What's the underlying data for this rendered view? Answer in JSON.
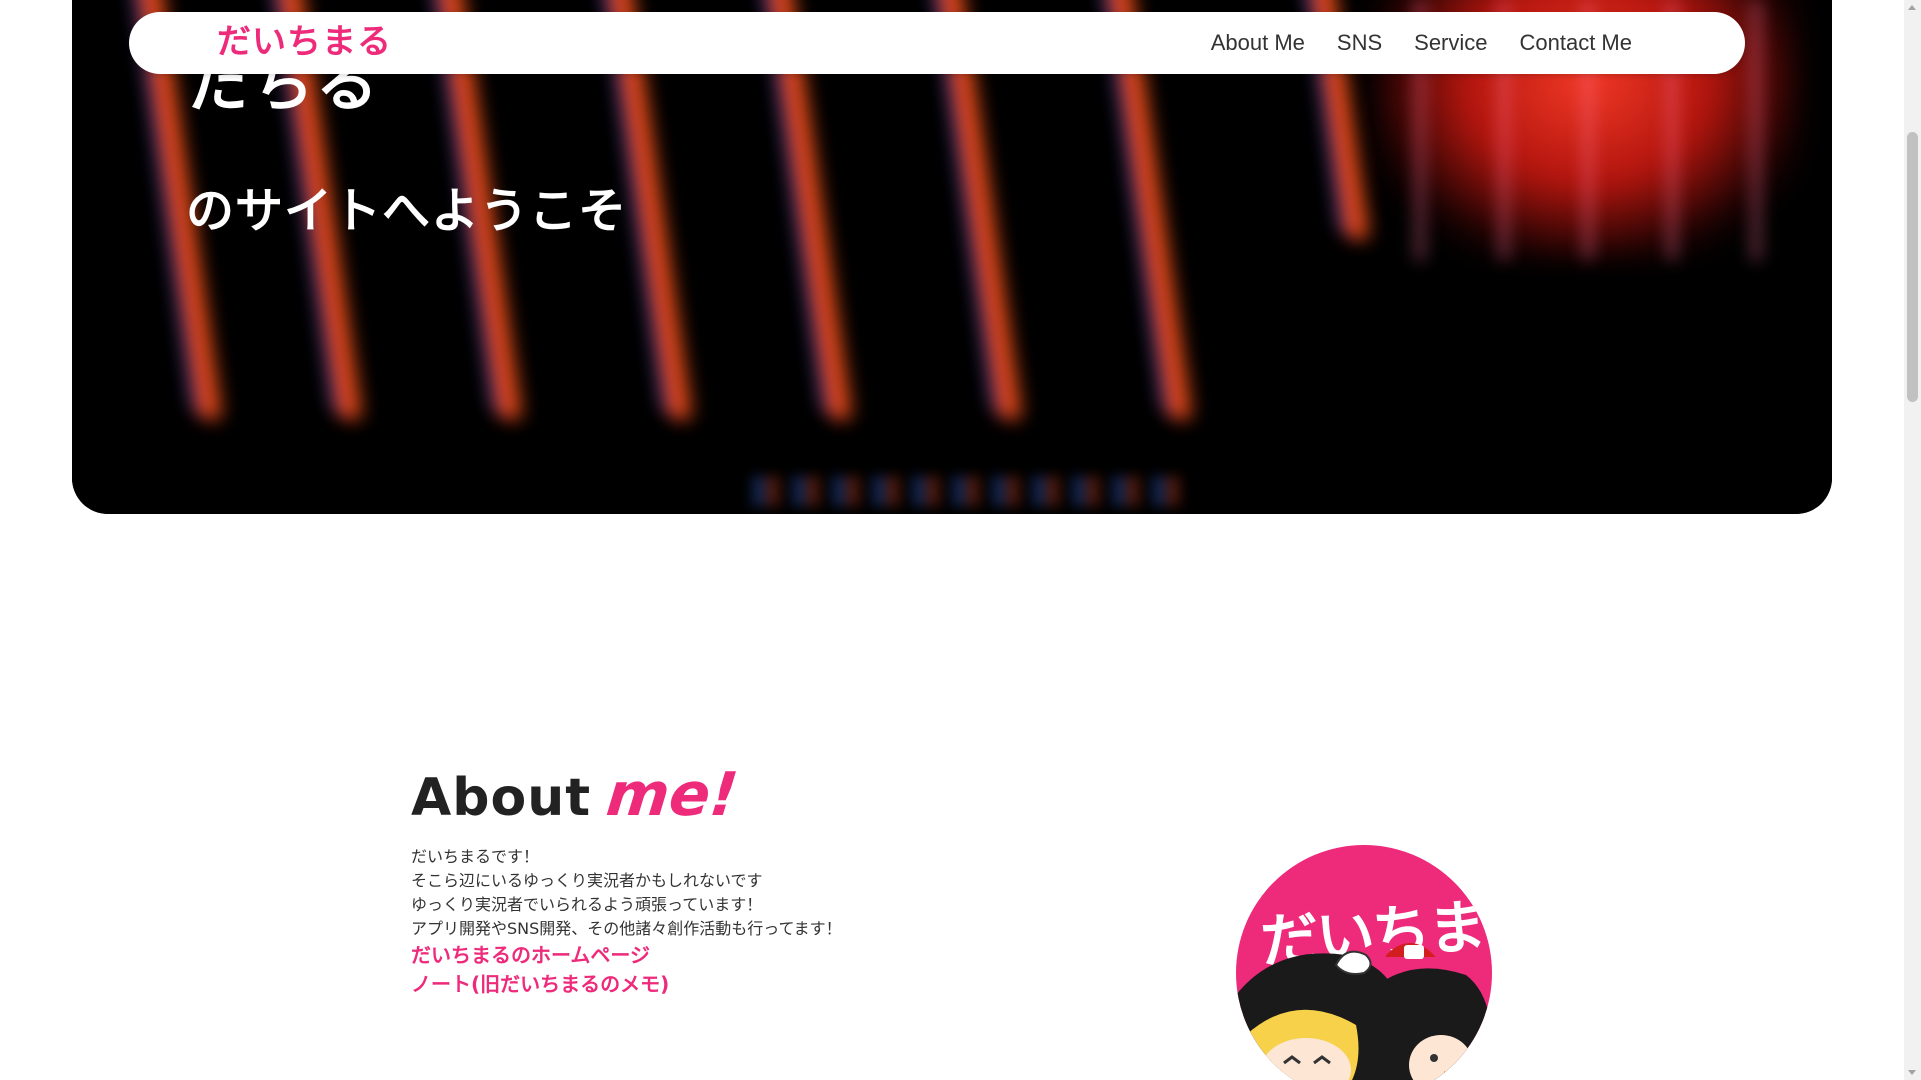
{
  "hero": {
    "title_top": "だちる",
    "subtitle": "のサイトへようこそ"
  },
  "navbar": {
    "logo": "だいちまる",
    "links": [
      "About Me",
      "SNS",
      "Service",
      "Contact Me"
    ]
  },
  "about": {
    "heading_about": "About",
    "heading_me": "me!",
    "lines": [
      "だいちまるです！",
      "そこら辺にいるゆっくり実況者かもしれないです",
      "ゆっくり実況者でいられるよう頑張っています！",
      "アプリ開発やSNS開発、その他諸々創作活動も行ってます！"
    ],
    "link_homepage": "だいちまるのホームページ",
    "link_note": "ノート(旧だいちまるのメモ)"
  },
  "avatar": {
    "text": "だいちまる"
  },
  "colors": {
    "accent": "#ee2a7b",
    "text": "#333333"
  }
}
